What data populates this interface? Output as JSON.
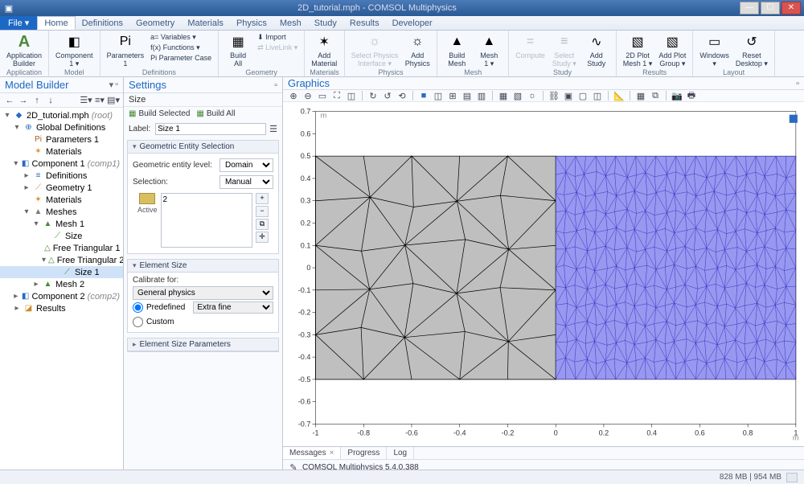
{
  "window": {
    "title": "2D_tutorial.mph - COMSOL Multiphysics"
  },
  "menubar": {
    "file": "File ▾",
    "tabs": [
      "Home",
      "Definitions",
      "Geometry",
      "Materials",
      "Physics",
      "Mesh",
      "Study",
      "Results",
      "Developer"
    ],
    "active": 0
  },
  "ribbon": {
    "groups": [
      {
        "label": "Application",
        "items": [
          {
            "label": "Application\nBuilder",
            "icon": "A",
            "big": true,
            "primary": true
          }
        ]
      },
      {
        "label": "Model",
        "items": [
          {
            "label": "Component\n1 ▾",
            "icon": "◧",
            "big": true
          }
        ]
      },
      {
        "label": "Definitions",
        "items": [
          {
            "label": "Parameters\n1",
            "icon": "Pi",
            "big": true
          },
          {
            "label": "a= Variables ▾",
            "icon": "",
            "sm": true
          },
          {
            "label": "f(x) Functions ▾",
            "icon": "",
            "sm": true
          },
          {
            "label": "Pi  Parameter Case",
            "icon": "",
            "sm": true
          }
        ]
      },
      {
        "label": "Geometry",
        "items": [
          {
            "label": "Build\nAll",
            "icon": "▦",
            "big": true
          },
          {
            "label": "⬇ Import",
            "icon": "",
            "sm": true
          },
          {
            "label": "⇄ LiveLink ▾",
            "icon": "",
            "sm": true,
            "disabled": true
          }
        ]
      },
      {
        "label": "Materials",
        "items": [
          {
            "label": "Add\nMaterial",
            "icon": "✶",
            "big": true
          }
        ]
      },
      {
        "label": "Physics",
        "items": [
          {
            "label": "Select Physics\nInterface ▾",
            "icon": "☼",
            "big": true,
            "disabled": true
          },
          {
            "label": "Add\nPhysics",
            "icon": "☼",
            "big": true
          }
        ]
      },
      {
        "label": "Mesh",
        "items": [
          {
            "label": "Build\nMesh",
            "icon": "▲",
            "big": true
          },
          {
            "label": "Mesh\n1 ▾",
            "icon": "▲",
            "big": true
          }
        ]
      },
      {
        "label": "Study",
        "items": [
          {
            "label": "Compute",
            "icon": "=",
            "big": true,
            "disabled": true
          },
          {
            "label": "Select\nStudy ▾",
            "icon": "≡",
            "big": true,
            "disabled": true
          },
          {
            "label": "Add\nStudy",
            "icon": "∿",
            "big": true
          }
        ]
      },
      {
        "label": "Results",
        "items": [
          {
            "label": "2D Plot\nMesh 1 ▾",
            "icon": "▧",
            "big": true
          },
          {
            "label": "Add Plot\nGroup ▾",
            "icon": "▧",
            "big": true
          }
        ]
      },
      {
        "label": "Layout",
        "items": [
          {
            "label": "Windows\n▾",
            "icon": "▭",
            "big": true
          },
          {
            "label": "Reset\nDesktop ▾",
            "icon": "↺",
            "big": true
          }
        ]
      }
    ]
  },
  "modelbuilder": {
    "title": "Model Builder",
    "tree": [
      {
        "d": 0,
        "exp": "▾",
        "icon": "◆",
        "color": "#2a6ac2",
        "label": "2D_tutorial.mph (root)",
        "italic": "(root)"
      },
      {
        "d": 1,
        "exp": "▾",
        "icon": "⊕",
        "color": "#2a6ac2",
        "label": "Global Definitions"
      },
      {
        "d": 2,
        "exp": "",
        "icon": "Pi",
        "color": "#b05a1a",
        "label": "Parameters 1"
      },
      {
        "d": 2,
        "exp": "",
        "icon": "✶",
        "color": "#d08a2a",
        "label": "Materials"
      },
      {
        "d": 1,
        "exp": "▾",
        "icon": "◧",
        "color": "#2a6ac2",
        "label": "Component 1 (comp1)",
        "italic": "(comp1)"
      },
      {
        "d": 2,
        "exp": "▸",
        "icon": "≡",
        "color": "#2a6ac2",
        "label": "Definitions"
      },
      {
        "d": 2,
        "exp": "▸",
        "icon": "⟋",
        "color": "#d08a2a",
        "label": "Geometry 1"
      },
      {
        "d": 2,
        "exp": "",
        "icon": "✶",
        "color": "#d08a2a",
        "label": "Materials"
      },
      {
        "d": 2,
        "exp": "▾",
        "icon": "▲",
        "color": "#7a7a7a",
        "label": "Meshes"
      },
      {
        "d": 3,
        "exp": "▾",
        "icon": "▲",
        "color": "#4a8a3a",
        "label": "Mesh 1"
      },
      {
        "d": 4,
        "exp": "",
        "icon": "⟋",
        "color": "#4a8a3a",
        "label": "Size"
      },
      {
        "d": 4,
        "exp": "",
        "icon": "△",
        "color": "#4a8a3a",
        "label": "Free Triangular 1"
      },
      {
        "d": 4,
        "exp": "▾",
        "icon": "△",
        "color": "#4a8a3a",
        "label": "Free Triangular 2"
      },
      {
        "d": 5,
        "exp": "",
        "icon": "⟋",
        "color": "#4a8a3a",
        "label": "Size 1",
        "selected": true
      },
      {
        "d": 3,
        "exp": "▸",
        "icon": "▲",
        "color": "#4a8a3a",
        "label": "Mesh 2"
      },
      {
        "d": 1,
        "exp": "▸",
        "icon": "◧",
        "color": "#2a6ac2",
        "label": "Component 2 (comp2)",
        "italic": "(comp2)"
      },
      {
        "d": 1,
        "exp": "▸",
        "icon": "◪",
        "color": "#d08a2a",
        "label": "Results"
      }
    ]
  },
  "settings": {
    "title": "Settings",
    "subtitle": "Size",
    "build_selected": "Build Selected",
    "build_all": "Build All",
    "label_label": "Label:",
    "label_value": "Size 1",
    "geom_section": "Geometric Entity Selection",
    "geom_level_label": "Geometric entity level:",
    "geom_level_value": "Domain",
    "selection_label": "Selection:",
    "selection_value": "Manual",
    "active_label": "Active",
    "active_list": "2",
    "elem_size_section": "Element Size",
    "calibrate_label": "Calibrate for:",
    "calibrate_value": "General physics",
    "predefined_label": "Predefined",
    "predefined_value": "Extra fine",
    "custom_label": "Custom",
    "params_section": "Element Size Parameters"
  },
  "graphics": {
    "title": "Graphics"
  },
  "chart_data": {
    "type": "mesh2d",
    "xlabel": "m",
    "ylabel": "m",
    "xlim": [
      -1,
      1
    ],
    "ylim": [
      -0.7,
      0.7
    ],
    "xticks": [
      -1,
      -0.8,
      -0.6,
      -0.4,
      -0.2,
      0,
      0.2,
      0.4,
      0.6,
      0.8,
      1
    ],
    "yticks": [
      -0.7,
      -0.6,
      -0.5,
      -0.4,
      -0.3,
      -0.2,
      -0.1,
      0,
      0.1,
      0.2,
      0.3,
      0.4,
      0.5,
      0.6,
      0.7
    ],
    "domains": [
      {
        "id": 1,
        "rect": [
          -1,
          -0.5,
          0,
          0.5
        ],
        "fill": "#bfbfbf",
        "mesh": "coarse"
      },
      {
        "id": 2,
        "rect": [
          0,
          -0.5,
          1,
          0.5
        ],
        "fill": "#9898f0",
        "mesh": "fine",
        "selected": true
      }
    ]
  },
  "bottom": {
    "tabs": [
      {
        "label": "Messages",
        "close": true,
        "active": true
      },
      {
        "label": "Progress"
      },
      {
        "label": "Log"
      }
    ],
    "message": "COMSOL Multiphysics 5.4.0.388"
  },
  "status": {
    "mem": "828 MB | 954 MB"
  }
}
